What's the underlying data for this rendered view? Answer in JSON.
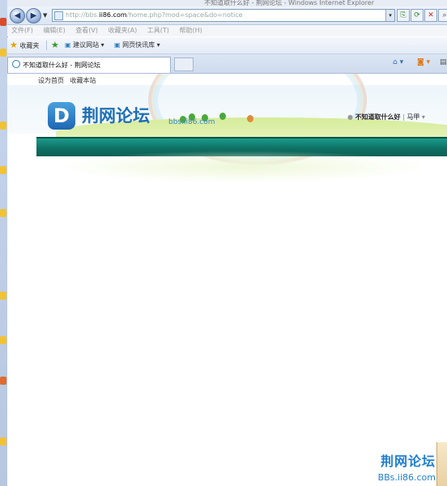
{
  "window": {
    "title": "不知道取什么好 - 荆网论坛 - Windows Internet Explorer"
  },
  "address": {
    "url_prefix": "http://bbs.",
    "url_domain": "ii86.com",
    "url_path": "/home.php?mod=space&do=notice"
  },
  "menu": {
    "items": [
      "文件(F)",
      "编辑(E)",
      "查看(V)",
      "收藏夹(A)",
      "工具(T)",
      "帮助(H)"
    ]
  },
  "favorites": {
    "label": "收藏夹",
    "suggested": "建议网站",
    "webslice": "网页快讯库"
  },
  "tab": {
    "title": "不知道取什么好 - 荆网论坛"
  },
  "page": {
    "topnav": [
      "设为首页",
      "收藏本站"
    ],
    "logo_glyph": "D",
    "logo_text": "荆网论坛",
    "logo_url": "bbs.ii86.com",
    "username": "不知道取什么好",
    "user_extra": "马甲",
    "watermark_title": "荆网论坛",
    "watermark_url": "BBs.ii86.com"
  },
  "colors": {
    "nav_bar": "#0f7163",
    "brand_blue": "#1f6fb5"
  }
}
